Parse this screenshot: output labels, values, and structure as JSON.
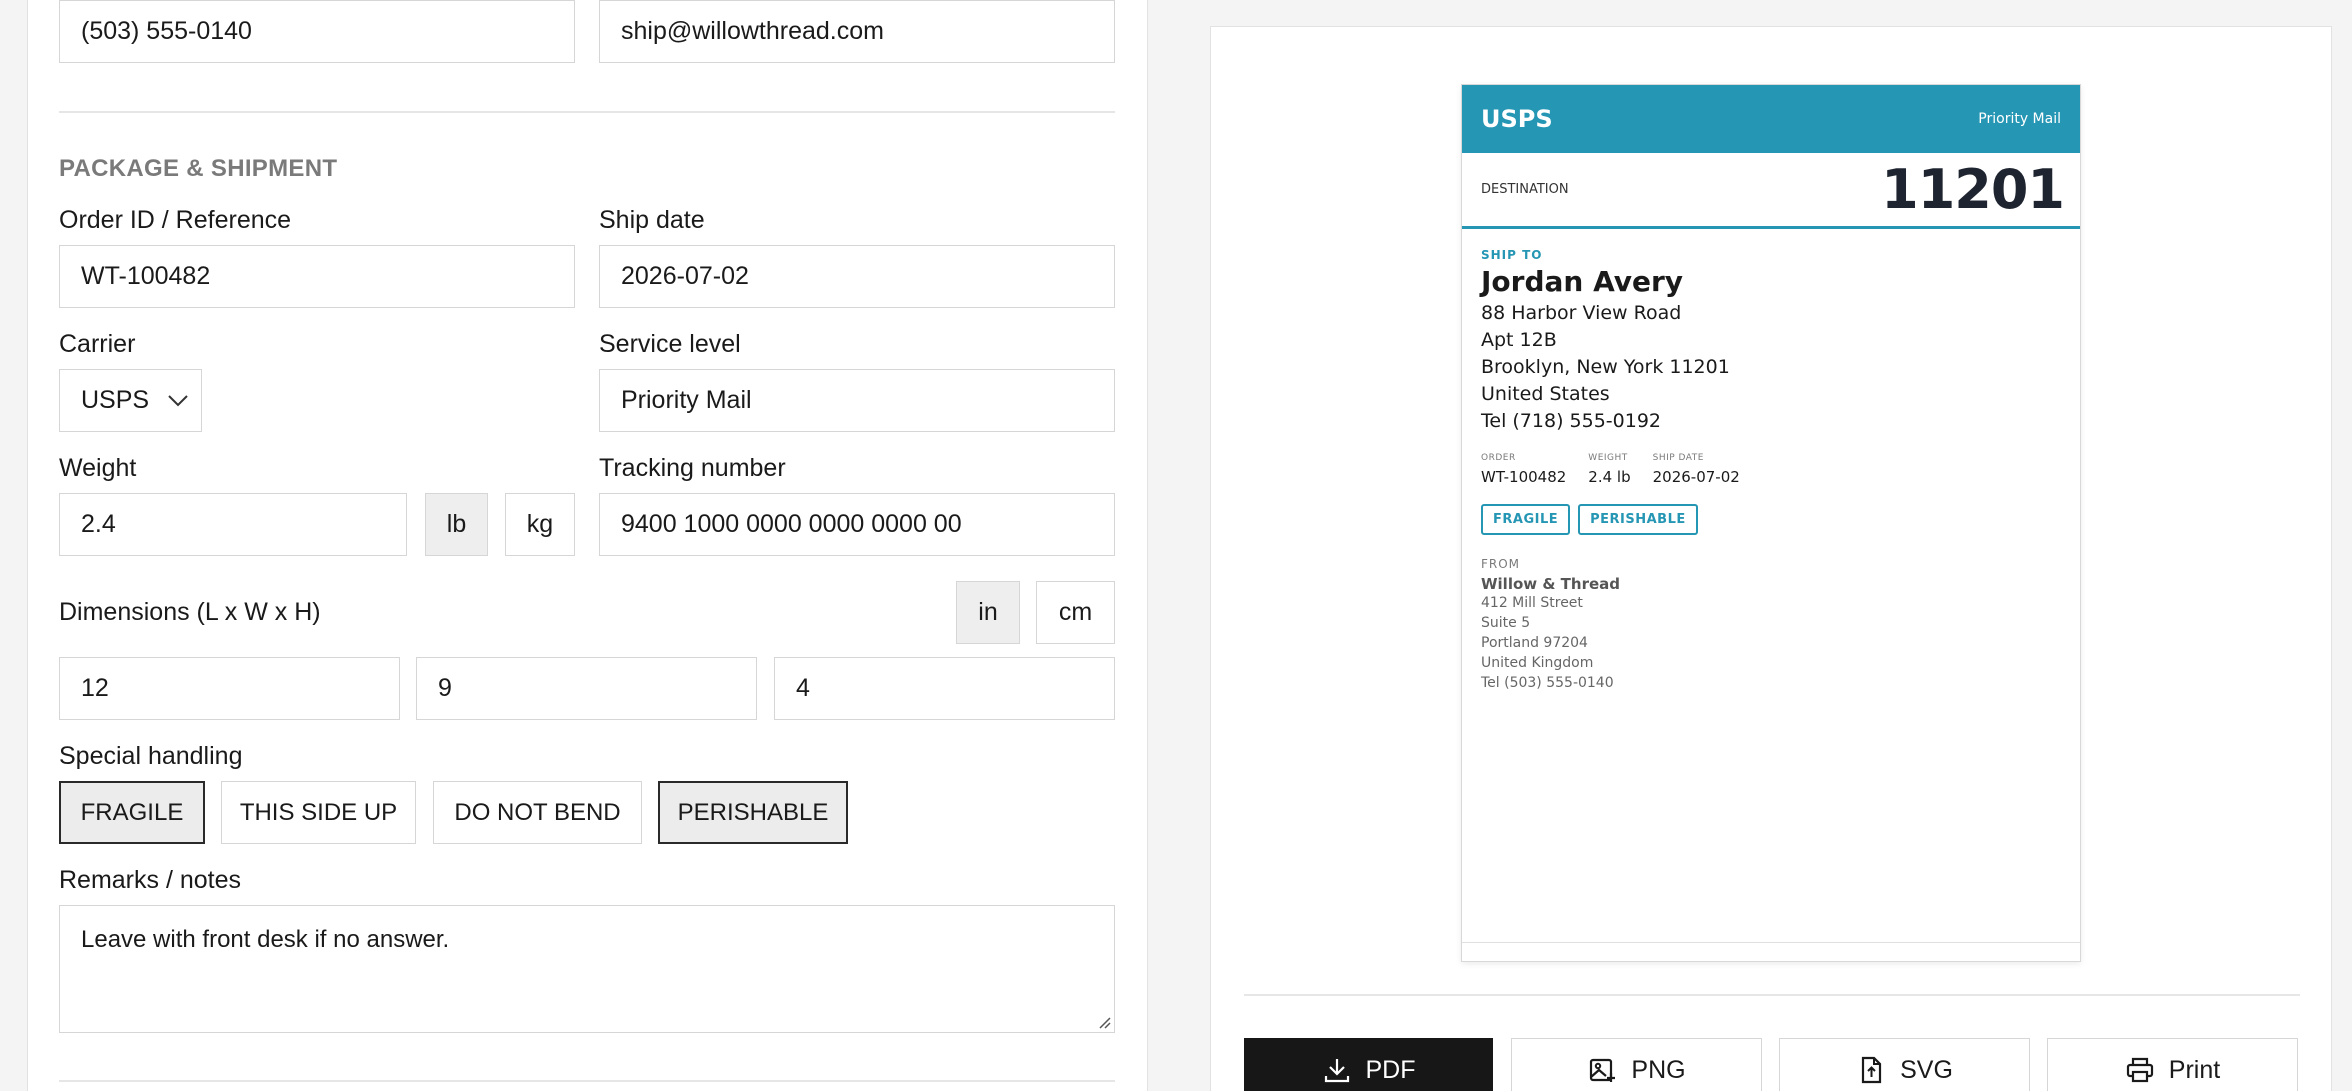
{
  "contact": {
    "phone": "(503) 555-0140",
    "email": "ship@willowthread.com"
  },
  "section_title": "PACKAGE & SHIPMENT",
  "fields": {
    "order_label": "Order ID / Reference",
    "order_value": "WT-100482",
    "ship_date_label": "Ship date",
    "ship_date_value": "2026-07-02",
    "carrier_label": "Carrier",
    "carrier_value": "USPS",
    "service_label": "Service level",
    "service_value": "Priority Mail",
    "weight_label": "Weight",
    "weight_value": "2.4",
    "weight_unit_lb": "lb",
    "weight_unit_kg": "kg",
    "tracking_label": "Tracking number",
    "tracking_value": "9400 1000 0000 0000 0000 00",
    "dimensions_label": "Dimensions (L x W x H)",
    "dim_unit_in": "in",
    "dim_unit_cm": "cm",
    "dim_l": "12",
    "dim_w": "9",
    "dim_h": "4",
    "handling_label": "Special handling",
    "remarks_label": "Remarks / notes",
    "remarks_value": "Leave with front desk if no answer."
  },
  "handling_tags": [
    "FRAGILE",
    "THIS SIDE UP",
    "DO NOT BEND",
    "PERISHABLE"
  ],
  "label": {
    "carrier": "USPS",
    "service": "Priority Mail",
    "destination_label": "DESTINATION",
    "destination_zip": "11201",
    "ship_to_label": "SHIP TO",
    "name": "Jordan Avery",
    "address": [
      "88 Harbor View Road",
      "Apt 12B",
      "Brooklyn, New York 11201",
      "United States",
      "Tel (718) 555-0192"
    ],
    "meta": {
      "order_k": "ORDER",
      "order_v": "WT-100482",
      "weight_k": "WEIGHT",
      "weight_v": "2.4 lb",
      "date_k": "SHIP DATE",
      "date_v": "2026-07-02"
    },
    "tags": [
      "FRAGILE",
      "PERISHABLE"
    ],
    "from_label": "FROM",
    "from_name": "Willow & Thread",
    "from_address": [
      "412 Mill Street",
      "Suite 5",
      "Portland 97204",
      "United Kingdom",
      "Tel (503) 555-0140"
    ]
  },
  "export": {
    "pdf": "PDF",
    "png": "PNG",
    "svg": "SVG",
    "print": "Print"
  },
  "icons": {
    "carrier_dropdown": "chevron-down-icon",
    "pdf": "download-icon",
    "png": "image-icon",
    "svg": "file-icon",
    "print": "printer-icon"
  }
}
